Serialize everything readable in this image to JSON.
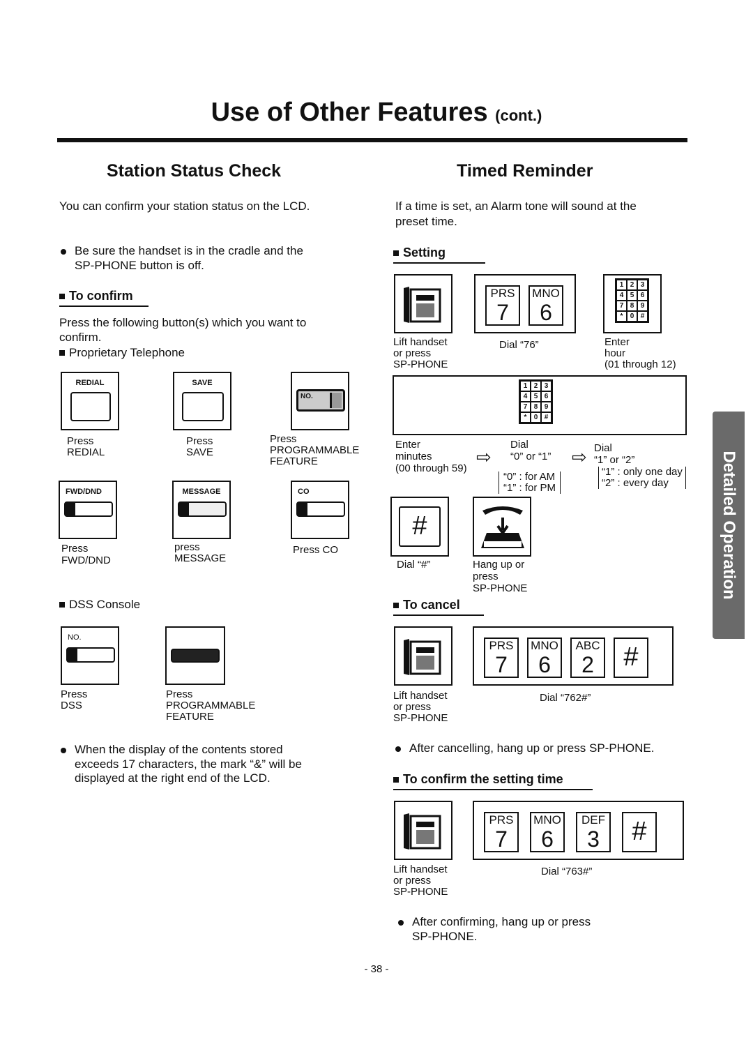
{
  "title": {
    "main": "Use of Other Features",
    "suffix": "(cont.)"
  },
  "left": {
    "heading": "Station Status Check",
    "intro": "You can confirm your station status on the LCD.",
    "bullet1": [
      "Be sure the handset is in the cradle and the",
      "SP-PHONE button is off."
    ],
    "to_confirm": "To confirm",
    "press_text": [
      "Press the following button(s) which you want to",
      "confirm."
    ],
    "prop_tel": "Proprietary Telephone",
    "buttons": [
      {
        "key": "REDIAL",
        "caption": [
          "Press",
          "REDIAL"
        ]
      },
      {
        "key": "SAVE",
        "caption": [
          "Press",
          "SAVE"
        ]
      },
      {
        "key": "NO.",
        "caption": [
          "Press",
          "PROGRAMMABLE",
          "FEATURE"
        ]
      },
      {
        "key": "FWD/DND",
        "caption": [
          "Press",
          "FWD/DND"
        ]
      },
      {
        "key": "MESSAGE",
        "caption": [
          "press",
          "MESSAGE"
        ]
      },
      {
        "key": "CO",
        "caption": [
          "Press CO"
        ]
      }
    ],
    "dss": "DSS Console",
    "dss_buttons": [
      {
        "key": "NO.",
        "caption": [
          "Press",
          "DSS"
        ]
      },
      {
        "key": "",
        "caption": [
          "Press",
          "PROGRAMMABLE",
          "FEATURE"
        ]
      }
    ],
    "bullet2": [
      "When the display of the contents stored",
      "exceeds 17 characters, the mark “&” will be",
      "displayed at the right end of the LCD."
    ]
  },
  "right": {
    "heading": "Timed Reminder",
    "intro": [
      "If a time is set, an Alarm tone will sound at the",
      "preset time."
    ],
    "setting": "Setting",
    "lift": [
      "Lift handset",
      "or press",
      "SP-PHONE"
    ],
    "dial76": "Dial “76”",
    "enter_hour": [
      "Enter",
      "hour",
      "(01 through 12)"
    ],
    "keys76": [
      {
        "l": "PRS",
        "d": "7"
      },
      {
        "l": "MNO",
        "d": "6"
      }
    ],
    "keypad": [
      "1",
      "2",
      "3",
      "4",
      "5",
      "6",
      "7",
      "8",
      "9",
      "*",
      "0",
      "#"
    ],
    "enter_min": [
      "Enter",
      "minutes",
      "(00 through 59)"
    ],
    "dial01": [
      "Dial",
      "“0” or “1”"
    ],
    "ampm": [
      "“0” : for AM",
      "“1” : for PM"
    ],
    "dial12": [
      "Dial",
      "“1” or “2”"
    ],
    "days": [
      "“1” : only one day",
      "“2” : every day"
    ],
    "hash_key": "#",
    "dial_hash": "Dial “#”",
    "hangup": [
      "Hang up or",
      "press",
      "SP-PHONE"
    ],
    "to_cancel": "To cancel",
    "keys762": [
      {
        "l": "PRS",
        "d": "7"
      },
      {
        "l": "MNO",
        "d": "6"
      },
      {
        "l": "ABC",
        "d": "2"
      },
      {
        "l": "",
        "d": "#"
      }
    ],
    "dial762": "Dial “762#”",
    "after_cancel": "After cancelling, hang up or press SP-PHONE.",
    "to_confirm_time": "To confirm the setting time",
    "keys763": [
      {
        "l": "PRS",
        "d": "7"
      },
      {
        "l": "MNO",
        "d": "6"
      },
      {
        "l": "DEF",
        "d": "3"
      },
      {
        "l": "",
        "d": "#"
      }
    ],
    "dial763": "Dial “763#”",
    "after_confirm": [
      "After confirming, hang up or press",
      "SP-PHONE."
    ]
  },
  "side_tab": "Detailed Operation",
  "page_number": "- 38 -"
}
